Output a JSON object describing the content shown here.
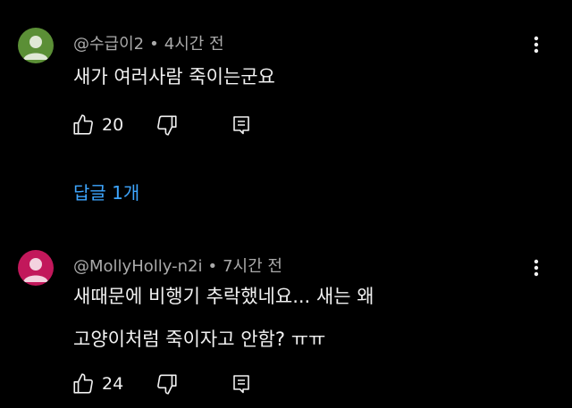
{
  "comments": [
    {
      "author": "@수급이2",
      "time": "4시간 전",
      "avatar_color": "#5b8f36",
      "lines": [
        "새가 여러사람 죽이는군요"
      ],
      "likes": "20",
      "replies_label": "답글 1개"
    },
    {
      "author": "@MollyHolly-n2i",
      "time": "7시간 전",
      "avatar_color": "#c2185b",
      "lines": [
        "새때문에 비행기 추락했네요... 새는 왜",
        "고양이처럼 죽이자고 안함? ㅠㅠ"
      ],
      "likes": "24"
    }
  ],
  "separator": "•",
  "icons": {
    "like": "thumbs-up-icon",
    "dislike": "thumbs-down-icon",
    "reply": "reply-icon",
    "menu": "more-vertical-icon"
  },
  "colors": {
    "background": "#000000",
    "text": "#f1f1f1",
    "meta": "#aaaaaa",
    "link": "#3ea6ff"
  }
}
